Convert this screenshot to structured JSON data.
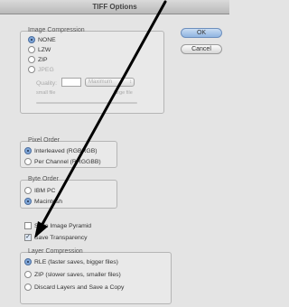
{
  "window": {
    "title": "TIFF Options"
  },
  "buttons": {
    "ok": "OK",
    "cancel": "Cancel"
  },
  "image_compression": {
    "legend": "Image Compression",
    "options": [
      "NONE",
      "LZW",
      "ZIP",
      "JPEG"
    ],
    "selected": "NONE",
    "quality_label": "Quality:",
    "quality_value": "",
    "quality_select": "Maximum",
    "small_file": "small file",
    "large_file": "large file"
  },
  "pixel_order": {
    "legend": "Pixel Order",
    "options": [
      "Interleaved (RGBRGB)",
      "Per Channel (RRGGBB)"
    ],
    "selected": "Interleaved (RGBRGB)"
  },
  "byte_order": {
    "legend": "Byte Order",
    "options": [
      "IBM PC",
      "Macintosh"
    ],
    "selected": "Macintosh"
  },
  "checkboxes": {
    "save_image_pyramid": {
      "label": "Save Image Pyramid",
      "checked": false
    },
    "save_transparency": {
      "label": "Save Transparency",
      "checked": true
    }
  },
  "layer_compression": {
    "legend": "Layer Compression",
    "options": [
      "RLE (faster saves, bigger files)",
      "ZIP (slower saves, smaller files)",
      "Discard Layers and Save a Copy"
    ],
    "selected": "RLE (faster saves, bigger files)"
  },
  "colors": {
    "arrow": "#000000",
    "accent": "#7fa6d8"
  }
}
